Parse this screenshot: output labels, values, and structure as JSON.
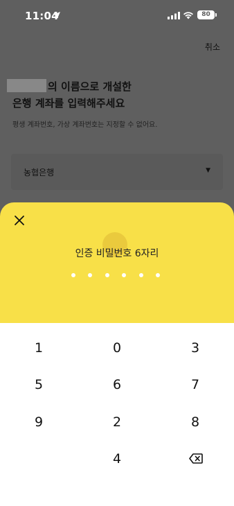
{
  "status_bar": {
    "time": "11:04",
    "battery": "80",
    "icons": [
      "location-arrow-icon",
      "signal-icon",
      "wifi-icon",
      "battery-icon"
    ]
  },
  "header": {
    "cancel_label": "취소"
  },
  "form": {
    "title_line1": "의 이름으로 개설한",
    "title_line2": "은행 계좌를 입력해주세요",
    "subtitle": "평생 계좌번호, 가상 계좌번호는 지정할 수 없어요.",
    "bank_selected": "농협은행",
    "bank_arrow": "▼"
  },
  "pin_sheet": {
    "title": "인증 비밀번호 6자리",
    "digits_total": 6,
    "digits_entered": 0,
    "close_icon": "close-icon",
    "background_color": "#f8e048"
  },
  "keypad": {
    "keys": [
      {
        "label": "1"
      },
      {
        "label": "0"
      },
      {
        "label": "3"
      },
      {
        "label": "5"
      },
      {
        "label": "6"
      },
      {
        "label": "7"
      },
      {
        "label": "9"
      },
      {
        "label": "2"
      },
      {
        "label": "8"
      },
      {
        "label": ""
      },
      {
        "label": "4"
      },
      {
        "label": "",
        "icon": "backspace-icon"
      }
    ]
  }
}
